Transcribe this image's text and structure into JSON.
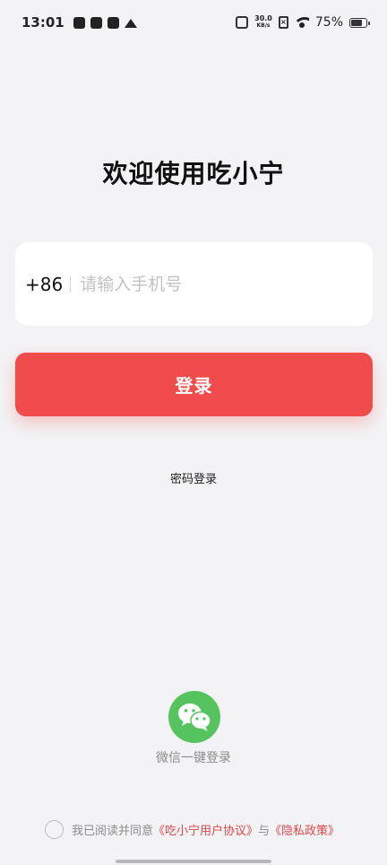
{
  "status_bar": {
    "time": "13:01",
    "network_speed_value": "30.0",
    "network_speed_unit": "KB/s",
    "battery_percent": "75%",
    "battery_level": 0.75,
    "icons": [
      "tiktok-icon",
      "mail-icon",
      "sync-icon",
      "crown-icon",
      "vibrate-icon",
      "no-sim-icon",
      "wifi-icon",
      "battery-icon"
    ]
  },
  "login": {
    "title": "欢迎使用吃小宁",
    "country_code": "+86",
    "phone_placeholder": "请输入手机号",
    "phone_value": "",
    "login_button": "登录",
    "password_login": "密码登录"
  },
  "wechat": {
    "label": "微信一键登录",
    "icon": "wechat-icon",
    "color": "#56c45e"
  },
  "agreement": {
    "prefix": "我已阅读并同意",
    "user_agreement": "《吃小宁用户协议》",
    "conjunction": "与",
    "privacy_policy": "《隐私政策》",
    "checked": false
  },
  "colors": {
    "accent": "#f14c4c",
    "link": "#e0474a",
    "background": "#f3f3f5"
  }
}
